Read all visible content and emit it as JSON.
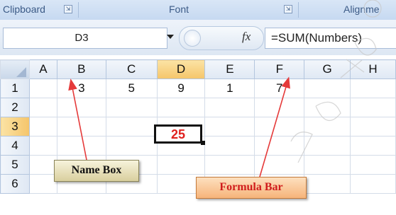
{
  "ribbon": {
    "groups": [
      {
        "label": "Clipboard",
        "launcher": "⇲"
      },
      {
        "label": "Font",
        "launcher": "⇲"
      },
      {
        "label": "Alignme"
      }
    ]
  },
  "formula_bar": {
    "name_box_value": "D3",
    "fx_label": "fx",
    "formula": "=SUM(Numbers)"
  },
  "sheet": {
    "columns": [
      "A",
      "B",
      "C",
      "D",
      "E",
      "F",
      "G",
      "H"
    ],
    "active_column": "D",
    "rows": [
      {
        "label": "1",
        "cells": [
          "",
          "3",
          "5",
          "9",
          "1",
          "7",
          "",
          ""
        ]
      },
      {
        "label": "2",
        "cells": [
          "",
          "",
          "",
          "",
          "",
          "",
          "",
          ""
        ]
      },
      {
        "label": "3",
        "cells": [
          "",
          "",
          "",
          "",
          "",
          "",
          "",
          ""
        ]
      },
      {
        "label": "4",
        "cells": [
          "",
          "",
          "",
          "",
          "",
          "",
          "",
          ""
        ]
      },
      {
        "label": "5",
        "cells": [
          "",
          "",
          "",
          "",
          "",
          "",
          "",
          ""
        ]
      },
      {
        "label": "6",
        "cells": [
          "",
          "",
          "",
          "",
          "",
          "",
          "",
          ""
        ]
      }
    ],
    "active_row": "3",
    "active_cell_value": "25",
    "active_cell_color": "#e0211f"
  },
  "callouts": {
    "name_box": "Name Box",
    "formula_bar": "Formula Bar"
  },
  "colors": {
    "callout_text_red": "#d01d1d",
    "arrow_red": "#e53a3a"
  }
}
